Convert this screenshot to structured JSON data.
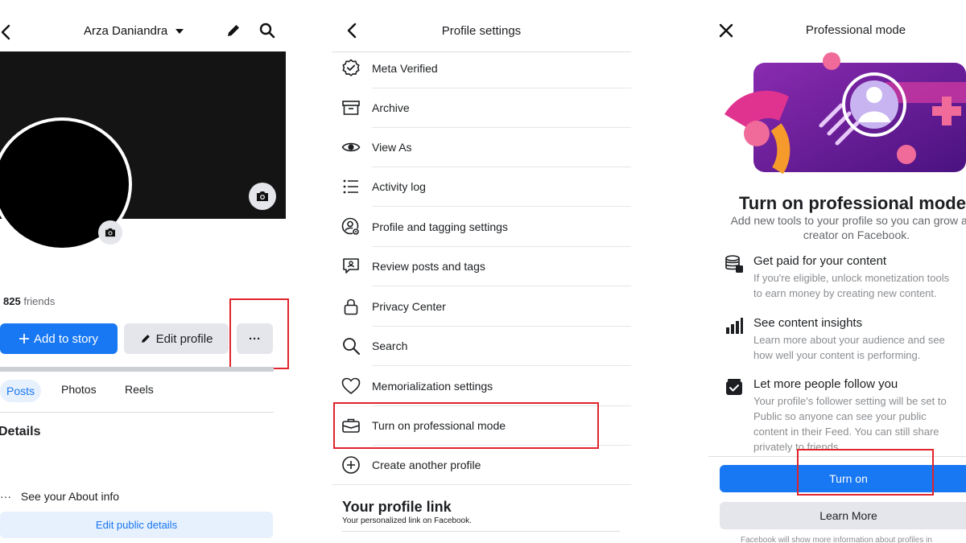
{
  "profile_screen": {
    "name": "Arza Daniandra",
    "friends_count": "825",
    "friends_label": "friends",
    "add_story_label": "Add to story",
    "edit_profile_label": "Edit profile",
    "more_label": "···",
    "tabs": [
      "Posts",
      "Photos",
      "Reels"
    ],
    "details_heading": "Details",
    "about_label": "See your About info",
    "about_dots": "···",
    "edit_public_label": "Edit public details"
  },
  "settings_screen": {
    "title": "Profile settings",
    "items": [
      {
        "label": "Meta Verified",
        "icon": "verified-badge-icon"
      },
      {
        "label": "Archive",
        "icon": "archive-icon"
      },
      {
        "label": "View As",
        "icon": "eye-icon"
      },
      {
        "label": "Activity log",
        "icon": "list-icon"
      },
      {
        "label": "Profile and tagging settings",
        "icon": "profile-gear-icon"
      },
      {
        "label": "Review posts and tags",
        "icon": "review-tags-icon"
      },
      {
        "label": "Privacy Center",
        "icon": "lock-icon"
      },
      {
        "label": "Search",
        "icon": "search-icon"
      },
      {
        "label": "Memorialization settings",
        "icon": "heart-icon"
      },
      {
        "label": "Turn on professional mode",
        "icon": "briefcase-icon"
      },
      {
        "label": "Create another profile",
        "icon": "plus-circle-icon"
      }
    ],
    "profile_link_title": "Your profile link",
    "profile_link_sub": "Your personalized link on Facebook."
  },
  "pro_screen": {
    "title": "Professional mode",
    "heading": "Turn on professional mode",
    "subtitle": "Add new tools to your profile so you can grow as a creator on Facebook.",
    "features": [
      {
        "title": "Get paid for your content",
        "desc_lines": [
          "If you're eligible, unlock monetization tools",
          "to earn money by creating new content."
        ],
        "icon": "money-stack-icon"
      },
      {
        "title": "See content insights",
        "desc_lines": [
          "Learn more about your audience and see",
          "how well your content is performing."
        ],
        "icon": "bar-chart-icon"
      },
      {
        "title": "Let more people follow you",
        "desc_lines": [
          "Your profile's follower setting will be set to",
          "Public so anyone can see your public",
          "content in their Feed. You can still share",
          "privately to friends."
        ],
        "icon": "checkmark-box-icon"
      }
    ],
    "turn_on_label": "Turn on",
    "learn_more_label": "Learn More",
    "footnote": "Facebook will show more information about profiles in"
  },
  "colors": {
    "accent": "#1877f2",
    "highlight": "#e0242c",
    "button_grey": "#e4e6eb",
    "illustration_purple": "#6a1a9a",
    "illustration_pink": "#f24a8a"
  }
}
